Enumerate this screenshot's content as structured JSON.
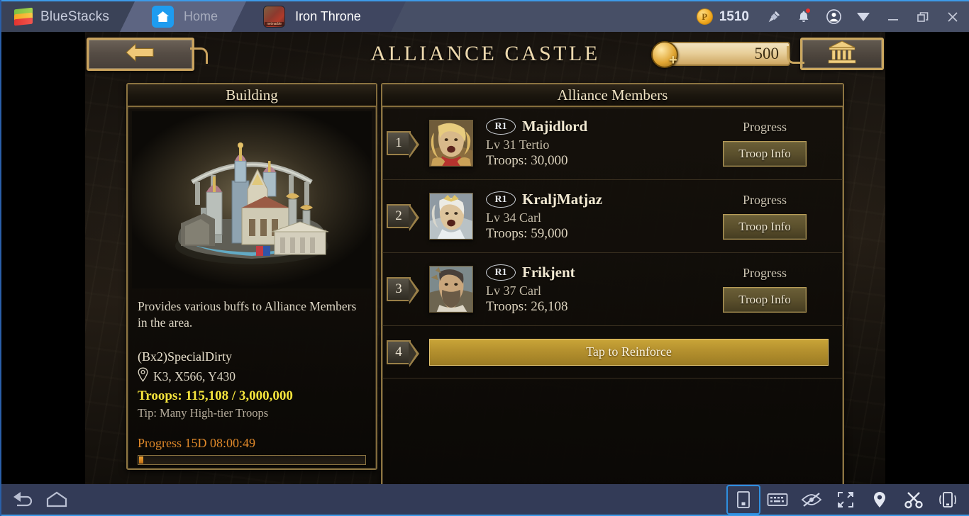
{
  "window": {
    "brand": "BlueStacks",
    "tabs": [
      {
        "label": "Home",
        "icon": "home-icon",
        "active": false
      },
      {
        "label": "Iron Throne",
        "icon": "game-icon",
        "active": true,
        "badge": "netmarble"
      }
    ],
    "points": "1510",
    "controls": {
      "points_symbol": "P",
      "pin_icon": "pin-icon",
      "bell_icon": "notification-bell-icon",
      "account_icon": "account-icon",
      "menu_icon": "chevron-down-menu-icon",
      "minimize_icon": "minimize-icon",
      "restore_icon": "restore-icon",
      "close_icon": "close-icon"
    }
  },
  "game": {
    "header": {
      "back_label": "←",
      "title": "ALLIANCE CASTLE",
      "gold_value": "500",
      "gold_plus": "+",
      "bank_icon": "bank-building-icon"
    },
    "building_panel": {
      "title": "Building",
      "image_alt": "alliance-castle-artwork",
      "description": "Provides various buffs to Alliance Members in the area.",
      "name": "(Bx2)SpecialDirty",
      "coords": "K3, X566, Y430",
      "coords_icon": "map-pin-icon",
      "troops": "Troops: 115,108 / 3,000,000",
      "tip": "Tip: Many High-tier Troops",
      "progress_label": "Progress 15D 08:00:49",
      "progress_percent": 2
    },
    "alliance_panel": {
      "title": "Alliance Members",
      "progress_column_label": "Progress",
      "troop_info_label": "Troop Info",
      "members": [
        {
          "rank_number": "1",
          "rank_badge": "R1",
          "name": "Majidlord",
          "level": "Lv 31 Tertio",
          "troops": "Troops: 30,000",
          "avatar": "avatar-majidlord"
        },
        {
          "rank_number": "2",
          "rank_badge": "R1",
          "name": "KraljMatjaz",
          "level": "Lv 34 Carl",
          "troops": "Troops: 59,000",
          "avatar": "avatar-kraljmatjaz"
        },
        {
          "rank_number": "3",
          "rank_badge": "R1",
          "name": "Frikjent",
          "level": "Lv 37 Carl",
          "troops": "Troops: 26,108",
          "avatar": "avatar-frikjent"
        }
      ],
      "reinforce": {
        "rank_number": "4",
        "label": "Tap to Reinforce"
      }
    }
  },
  "bottombar": {
    "left": [
      {
        "name": "back-icon"
      },
      {
        "name": "home-icon"
      }
    ],
    "right": [
      {
        "name": "portrait-mode-icon",
        "selected": true
      },
      {
        "name": "keyboard-icon",
        "selected": false
      },
      {
        "name": "eye-slash-icon",
        "selected": false
      },
      {
        "name": "fullscreen-icon",
        "selected": false
      },
      {
        "name": "location-pin-icon",
        "selected": false
      },
      {
        "name": "scissors-icon",
        "selected": false
      },
      {
        "name": "shake-device-icon",
        "selected": false
      }
    ]
  },
  "colors": {
    "accent_blue": "#3d9ae8",
    "titlebar": "#474f66",
    "gold": "#caa35e",
    "troops_yellow": "#f5e43c",
    "progress_orange": "#e0892a",
    "reinforce_gold": "#b4902e"
  }
}
